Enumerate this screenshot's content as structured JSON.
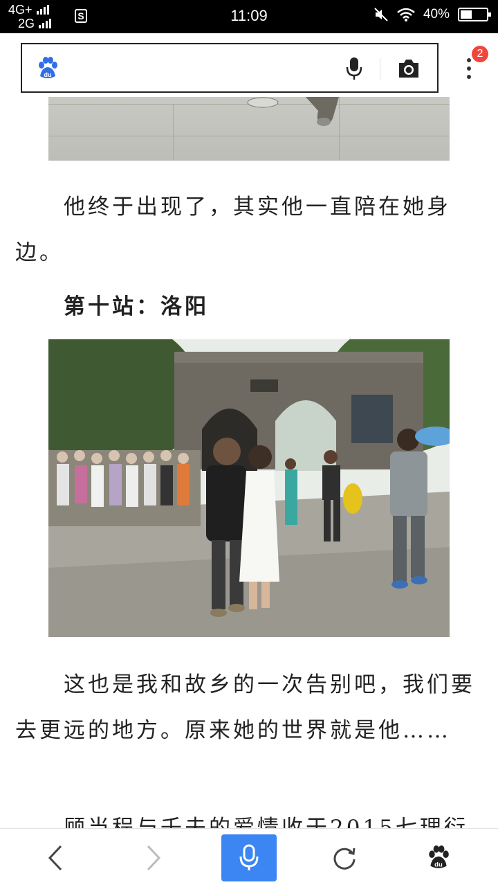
{
  "status": {
    "network_top": "4G+",
    "network_bottom": "2G",
    "sim_icon": "S",
    "time": "11:09",
    "battery": "40%"
  },
  "header": {
    "logo_text": "du",
    "badge_count": "2"
  },
  "content": {
    "para1": "他终于出现了，其实他一直陪在她身边。",
    "heading": "第十站：洛阳",
    "para2": "这也是我和故乡的一次告别吧，我们要去更远的地方。原来她的世界就是他……",
    "para3_partial": "顾当程与壬夫的爱情收于2015七理衍"
  },
  "nav": {
    "home_logo_text": "du"
  },
  "colors": {
    "accent": "#3b86f2",
    "badge": "#f0473a"
  }
}
